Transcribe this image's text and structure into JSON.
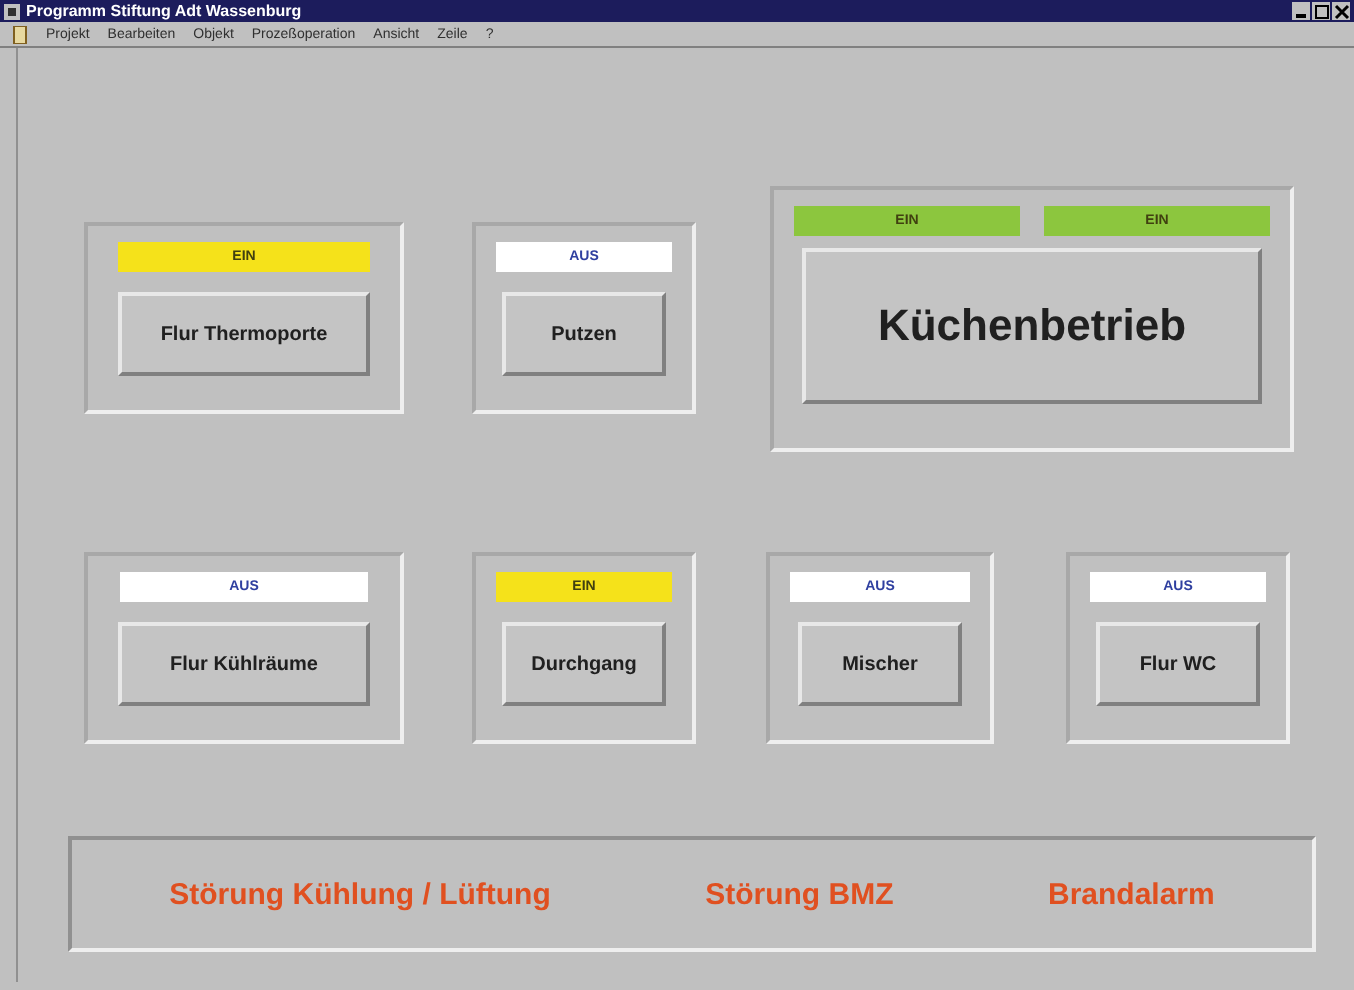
{
  "window": {
    "title": "Programm Stiftung Adt Wassenburg"
  },
  "menu": [
    "Projekt",
    "Bearbeiten",
    "Objekt",
    "Prozeßoperation",
    "Ansicht",
    "Zeile",
    "?"
  ],
  "rows": [
    [
      {
        "indicators": [
          {
            "text": "EIN",
            "color": "#f5e21a"
          }
        ],
        "label": "Flur Thermoporte",
        "kind": "standard"
      },
      {
        "indicators": [
          {
            "text": "AUS",
            "color": "#ffffff"
          }
        ],
        "label": "Putzen",
        "kind": "standard"
      },
      {
        "indicators": [
          {
            "text": "EIN",
            "color": "#8cc63e"
          },
          {
            "text": "EIN",
            "color": "#8cc63e"
          }
        ],
        "label": "Küchenbetrieb",
        "kind": "main"
      }
    ],
    [
      {
        "indicators": [
          {
            "text": "AUS",
            "color": "#ffffff"
          }
        ],
        "label": "Flur Kühlräume",
        "kind": "standard"
      },
      {
        "indicators": [
          {
            "text": "EIN",
            "color": "#f5e21a"
          }
        ],
        "label": "Durchgang",
        "kind": "standard"
      },
      {
        "indicators": [
          {
            "text": "AUS",
            "color": "#ffffff"
          }
        ],
        "label": "Mischer",
        "kind": "standard"
      },
      {
        "indicators": [
          {
            "text": "AUS",
            "color": "#ffffff"
          }
        ],
        "label": "Flur WC",
        "kind": "standard"
      }
    ]
  ],
  "alarms": [
    "Störung Kühlung / Lüftung",
    "Störung BMZ",
    "Brandalarm"
  ]
}
